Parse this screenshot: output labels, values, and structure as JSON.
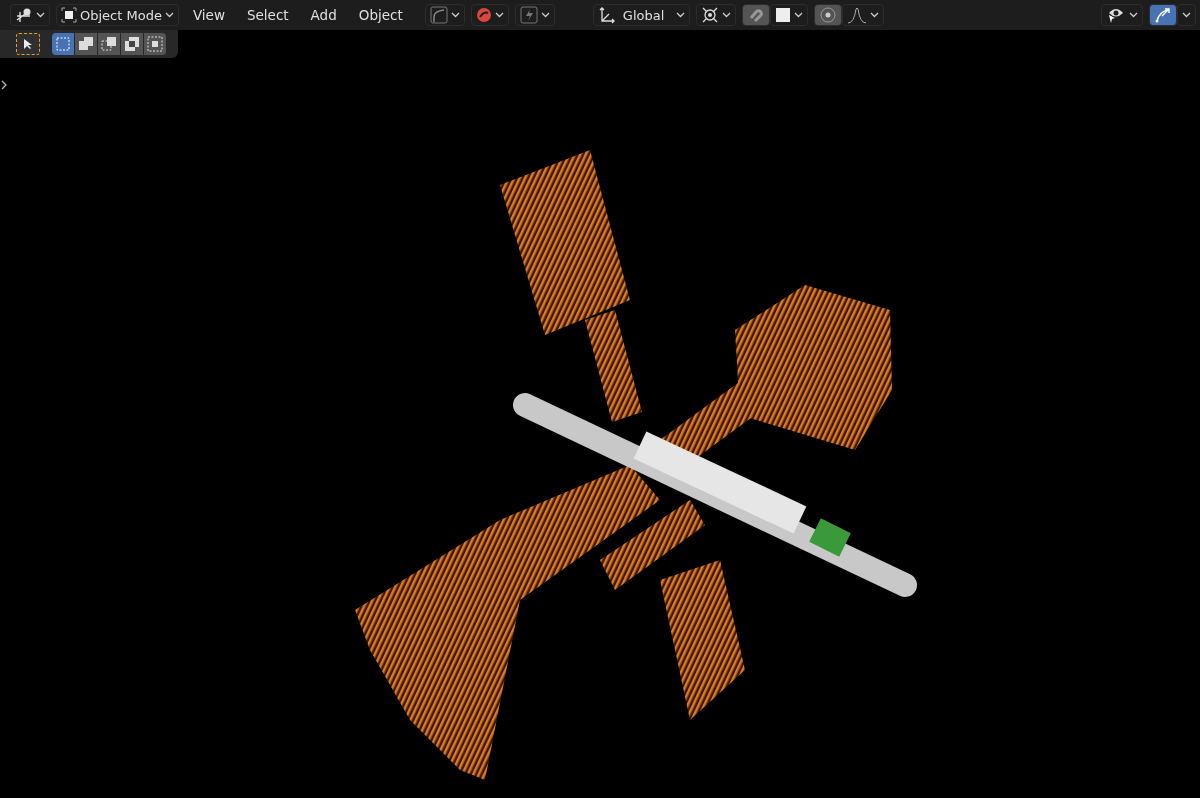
{
  "header": {
    "mode": {
      "label": "Object Mode"
    },
    "menus": [
      "View",
      "Select",
      "Add",
      "Object"
    ],
    "orientation": {
      "label": "Global"
    },
    "snap": {
      "on": true
    },
    "proportional": {
      "on": true
    },
    "gizmos": {
      "on": true
    }
  },
  "tool_settings": {
    "active_tool": {
      "selected": true
    },
    "select_modes": [
      {
        "kind": "set",
        "selected": true
      },
      {
        "kind": "extend",
        "selected": false
      },
      {
        "kind": "subtract",
        "selected": false
      },
      {
        "kind": "invert",
        "selected": false
      },
      {
        "kind": "intersect",
        "selected": false
      }
    ]
  }
}
